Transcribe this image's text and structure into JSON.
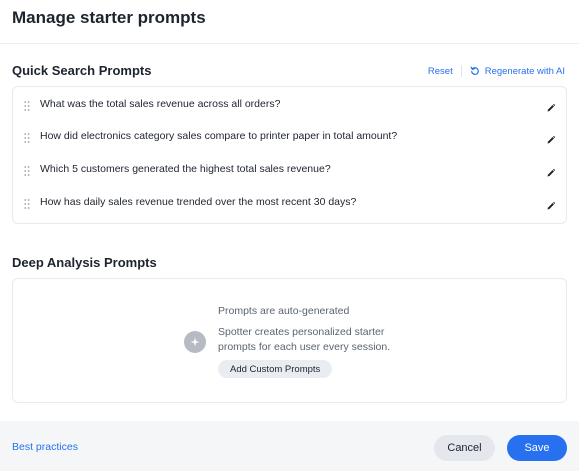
{
  "dialog": {
    "title": "Manage starter prompts"
  },
  "quick_search": {
    "title": "Quick Search Prompts",
    "reset_label": "Reset",
    "regenerate_label": "Regenerate with AI",
    "prompts": [
      "What was the total sales revenue across all orders?",
      "How did electronics category sales compare to printer paper in total amount?",
      "Which 5 customers generated the highest total sales revenue?",
      "How has daily sales revenue trended over the most recent 30 days?"
    ]
  },
  "deep_analysis": {
    "title": "Deep Analysis Prompts",
    "heading": "Prompts are auto-generated",
    "description": "Spotter creates personalized starter prompts for each user every session.",
    "add_button_label": "Add Custom Prompts"
  },
  "footer": {
    "best_practices_label": "Best practices",
    "cancel_label": "Cancel",
    "save_label": "Save"
  },
  "colors": {
    "accent": "#2770ef",
    "text": "#1d232f",
    "muted": "#5b6472"
  },
  "icons": [
    "drag-handle-icon",
    "pencil-icon",
    "regenerate-icon",
    "sparkle-icon"
  ]
}
